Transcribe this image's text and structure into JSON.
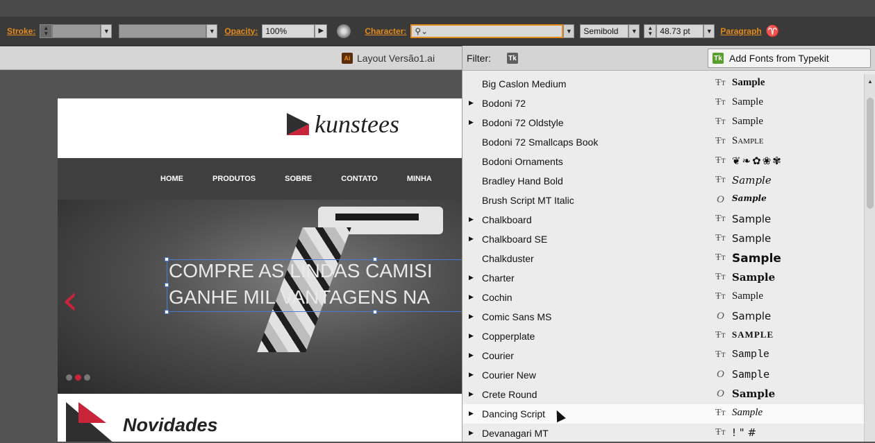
{
  "control_bar": {
    "stroke_label": "Stroke:",
    "opacity_label": "Opacity:",
    "opacity_value": "100%",
    "character_label": "Character:",
    "font_search_value": "",
    "font_style": "Semibold",
    "font_size": "48.73 pt",
    "paragraph_label": "Paragraph"
  },
  "document": {
    "tab_title": "Layout Versão1.ai",
    "file_icon": "illustrator-file-icon"
  },
  "artboard": {
    "logo_text": "kunstees",
    "nav_items": [
      "HOME",
      "PRODUTOS",
      "SOBRE",
      "CONTATO",
      "MINHA"
    ],
    "hero_line_1": "COMPRE AS LINDAS CAMISI",
    "hero_line_2": "GANHE MIL VANTAGENS NA",
    "section_title": "Novidades",
    "accent_color": "#c8243a"
  },
  "font_panel": {
    "filter_label": "Filter:",
    "add_fonts_label": "Add Fonts from Typekit",
    "fonts": [
      {
        "name": "Big Caslon Medium",
        "expandable": false,
        "type": "truetype",
        "sample": "Sample"
      },
      {
        "name": "Bodoni 72",
        "expandable": true,
        "type": "truetype",
        "sample": "Sample"
      },
      {
        "name": "Bodoni 72 Oldstyle",
        "expandable": true,
        "type": "truetype",
        "sample": "Sample"
      },
      {
        "name": "Bodoni 72 Smallcaps Book",
        "expandable": false,
        "type": "truetype",
        "sample": "Sample"
      },
      {
        "name": "Bodoni Ornaments",
        "expandable": false,
        "type": "truetype",
        "sample": "❦❧✿❀✾"
      },
      {
        "name": "Bradley Hand Bold",
        "expandable": false,
        "type": "truetype",
        "sample": "Sample"
      },
      {
        "name": "Brush Script MT Italic",
        "expandable": false,
        "type": "opentype",
        "sample": "Sample"
      },
      {
        "name": "Chalkboard",
        "expandable": true,
        "type": "truetype",
        "sample": "Sample"
      },
      {
        "name": "Chalkboard SE",
        "expandable": true,
        "type": "truetype",
        "sample": "Sample"
      },
      {
        "name": "Chalkduster",
        "expandable": false,
        "type": "truetype",
        "sample": "Sample"
      },
      {
        "name": "Charter",
        "expandable": true,
        "type": "truetype",
        "sample": "Sample"
      },
      {
        "name": "Cochin",
        "expandable": true,
        "type": "truetype",
        "sample": "Sample"
      },
      {
        "name": "Comic Sans MS",
        "expandable": true,
        "type": "opentype",
        "sample": "Sample"
      },
      {
        "name": "Copperplate",
        "expandable": true,
        "type": "truetype",
        "sample": "SAMPLE"
      },
      {
        "name": "Courier",
        "expandable": true,
        "type": "truetype",
        "sample": "Sample"
      },
      {
        "name": "Courier New",
        "expandable": true,
        "type": "opentype",
        "sample": "Sample"
      },
      {
        "name": "Crete Round",
        "expandable": true,
        "type": "opentype",
        "sample": "Sample"
      },
      {
        "name": "Dancing Script",
        "expandable": true,
        "type": "truetype",
        "sample": "Sample"
      },
      {
        "name": "Devanagari MT",
        "expandable": true,
        "type": "truetype",
        "sample": "! \" #"
      }
    ],
    "highlighted_index": 17
  }
}
